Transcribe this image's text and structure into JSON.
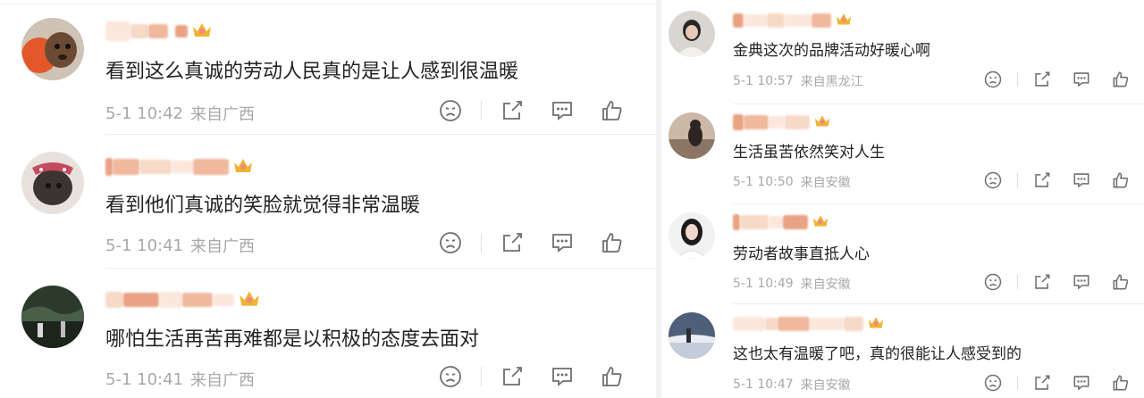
{
  "left_comments": [
    {
      "text": "看到这么真诚的劳动人民真的是让人感到很温暖",
      "time": "5-1 10:42",
      "location": "来自广西"
    },
    {
      "text": "看到他们真诚的笑脸就觉得非常温暖",
      "time": "5-1 10:41",
      "location": "来自广西"
    },
    {
      "text": "哪怕生活再苦再难都是以积极的态度去面对",
      "time": "5-1 10:41",
      "location": "来自广西"
    }
  ],
  "right_comments": [
    {
      "text": "金典这次的品牌活动好暖心啊",
      "time": "5-1 10:57",
      "location": "来自黑龙江"
    },
    {
      "text": "生活虽苦依然笑对人生",
      "time": "5-1 10:50",
      "location": "来自安徽"
    },
    {
      "text": "劳动者故事直抵人心",
      "time": "5-1 10:49",
      "location": "来自安徽"
    },
    {
      "text": "这也太有温暖了吧，真的很能让人感受到的",
      "time": "5-1 10:47",
      "location": "来自安徽"
    }
  ],
  "icons": {
    "dislike": "frown-face-icon",
    "share": "share-icon",
    "comment": "comment-icon",
    "like": "thumbs-up-icon",
    "badge": "crown-badge-icon"
  },
  "colors": {
    "text": "#222222",
    "meta": "#a8a8a8",
    "icon": "#6f6f6f",
    "crown": "#f2b233",
    "mosaic": [
      "#f7d9c8",
      "#f0b89d",
      "#e9a283",
      "#fbe7dc"
    ]
  }
}
